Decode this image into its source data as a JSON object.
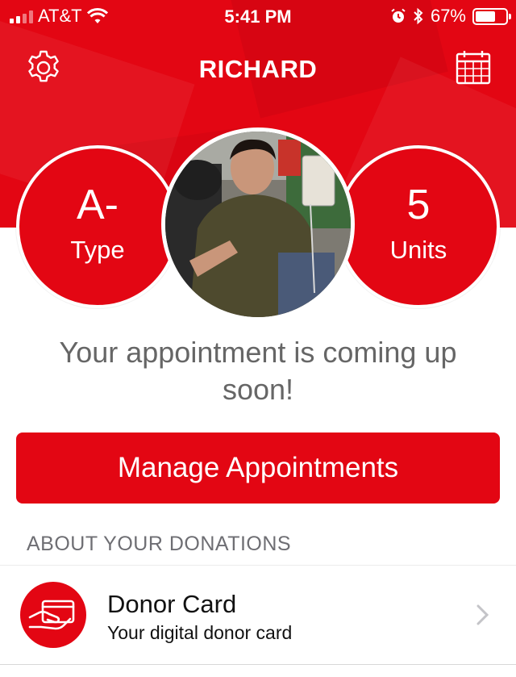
{
  "status_bar": {
    "carrier": "AT&T",
    "time": "5:41 PM",
    "battery": "67%",
    "battery_level": 0.67
  },
  "nav": {
    "title": "RICHARD",
    "left_icon": "gear-icon",
    "right_icon": "calendar-icon"
  },
  "stats": {
    "blood_type_value": "A-",
    "blood_type_label": "Type",
    "units_value": "5",
    "units_label": "Units"
  },
  "message": "Your appointment is coming up soon!",
  "manage_button": "Manage Appointments",
  "section_header": "ABOUT YOUR DONATIONS",
  "donor_card": {
    "title": "Donor Card",
    "subtitle": "Your digital donor card",
    "icon": "donor-card-icon"
  },
  "colors": {
    "brand_red": "#e30613",
    "text_gray": "#666666"
  }
}
